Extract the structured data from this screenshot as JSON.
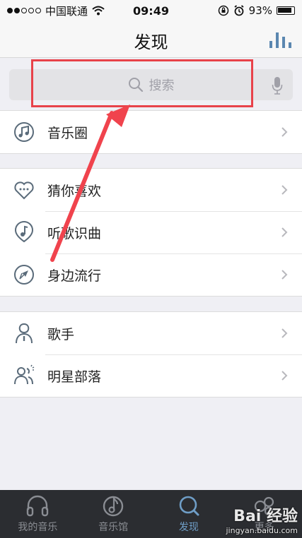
{
  "status_bar": {
    "carrier": "中国联通",
    "time": "09:49",
    "battery": "93%"
  },
  "nav": {
    "title": "发现"
  },
  "search": {
    "placeholder": "搜索"
  },
  "groups": [
    {
      "items": [
        {
          "label": "音乐圈",
          "icon": "music-circle-icon"
        }
      ]
    },
    {
      "items": [
        {
          "label": "猜你喜欢",
          "icon": "heart-chat-icon"
        },
        {
          "label": "听歌识曲",
          "icon": "music-note-pin-icon"
        },
        {
          "label": "身边流行",
          "icon": "compass-icon"
        }
      ]
    },
    {
      "items": [
        {
          "label": "歌手",
          "icon": "singer-icon"
        },
        {
          "label": "明星部落",
          "icon": "stars-group-icon"
        }
      ]
    }
  ],
  "tabs": [
    {
      "label": "我的音乐",
      "icon": "headphones-icon",
      "active": false
    },
    {
      "label": "音乐馆",
      "icon": "music-hall-icon",
      "active": false
    },
    {
      "label": "发现",
      "icon": "discover-icon",
      "active": true
    },
    {
      "label": "更多",
      "icon": "more-icon",
      "active": false
    }
  ],
  "watermark": {
    "logo": "Bai 经验",
    "url": "jingyan.baidu.com"
  },
  "colors": {
    "accent": "#6f9ec7",
    "highlight": "#e8424a",
    "tab_bar": "#2b2d31"
  }
}
